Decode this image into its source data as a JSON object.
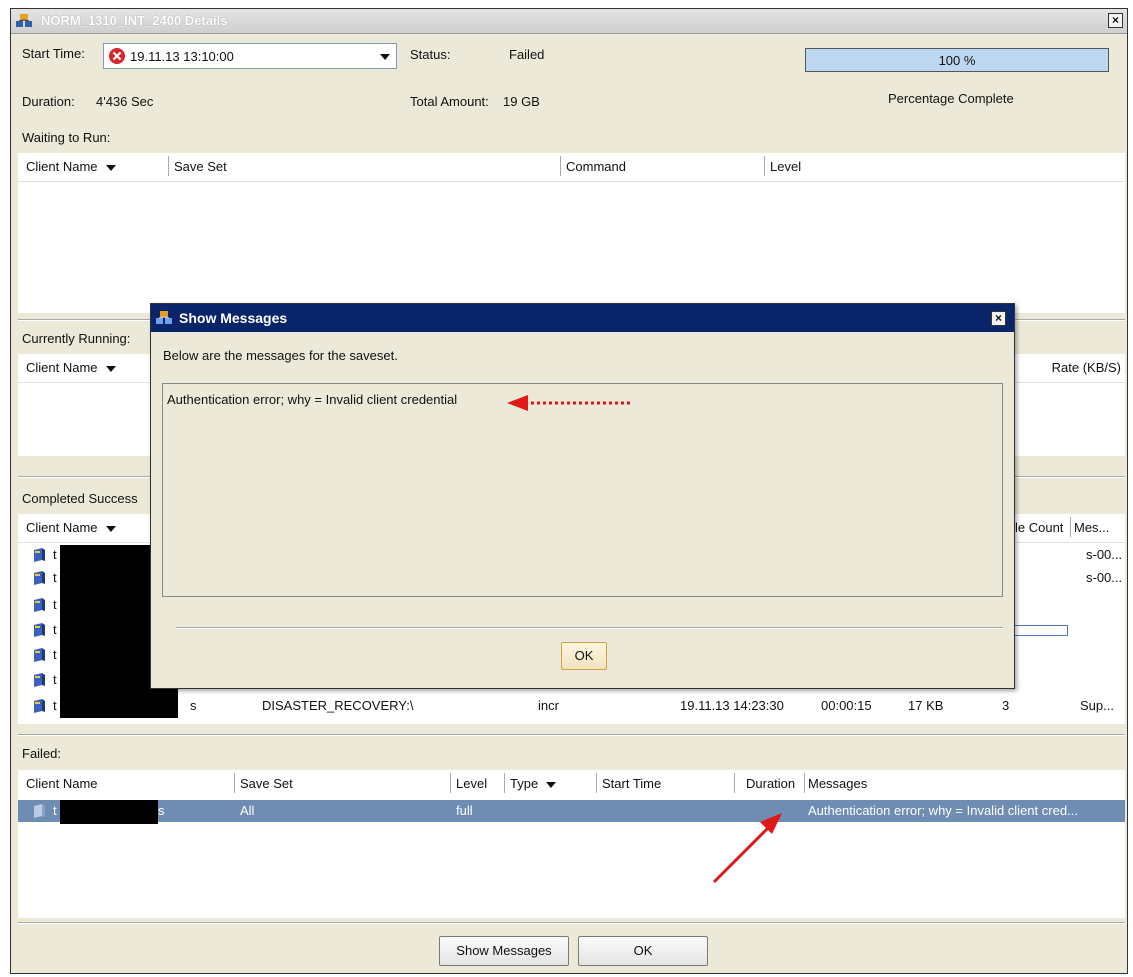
{
  "window": {
    "title": "NORM_1310_INT_2400 Details",
    "close_glyph": "×"
  },
  "summary": {
    "start_time_label": "Start Time:",
    "start_time_value": "19.11.13 13:10:00",
    "status_label": "Status:",
    "status_value": "Failed",
    "progress_percent": 100,
    "progress_text": "100 %",
    "percentage_label": "Percentage Complete",
    "duration_label": "Duration:",
    "duration_value": "4'436 Sec",
    "total_amount_label": "Total Amount:",
    "total_amount_value": "19 GB"
  },
  "waiting": {
    "title": "Waiting to Run:",
    "headers": {
      "client": "Client Name",
      "saveset": "Save Set",
      "command": "Command",
      "level": "Level"
    }
  },
  "running": {
    "title": "Currently Running:",
    "headers": {
      "client": "Client Name",
      "rate": "Rate (KB/S)"
    }
  },
  "completed": {
    "title": "Completed Success",
    "headers": {
      "client": "Client Name",
      "filecount": "le Count",
      "messages": "Mes..."
    },
    "rows": [
      {
        "t": "t",
        "msg": "s-00..."
      },
      {
        "t": "t",
        "msg": "s-00..."
      },
      {
        "t": "t"
      },
      {
        "t": "t"
      },
      {
        "t": "t"
      },
      {
        "t": "t"
      },
      {
        "t": "t",
        "trail": "s",
        "saveset": "DISASTER_RECOVERY:\\",
        "level": "incr",
        "start": "19.11.13 14:23:30",
        "duration": "00:00:15",
        "size": "17 KB",
        "count": "3",
        "msg": "Sup..."
      }
    ]
  },
  "failed": {
    "title": "Failed:",
    "headers": {
      "client": "Client Name",
      "saveset": "Save Set",
      "level": "Level",
      "type": "Type",
      "start": "Start Time",
      "duration": "Duration",
      "messages": "Messages"
    },
    "row": {
      "t": "t",
      "trail": "s",
      "saveset": "All",
      "level": "full",
      "message": "Authentication error; why = Invalid client cred..."
    }
  },
  "buttons": {
    "show_messages": "Show Messages",
    "ok": "OK"
  },
  "dialog": {
    "title": "Show Messages",
    "intro": "Below are the messages for the saveset.",
    "message": "Authentication error; why = Invalid client credential",
    "ok": "OK",
    "close_glyph": "×"
  },
  "colors": {
    "dialog_titlebar": "#0a246a",
    "selected_row": "#6f8cb2",
    "annotation_arrow": "#e01818",
    "progress_fill": "#bdd7f3"
  }
}
